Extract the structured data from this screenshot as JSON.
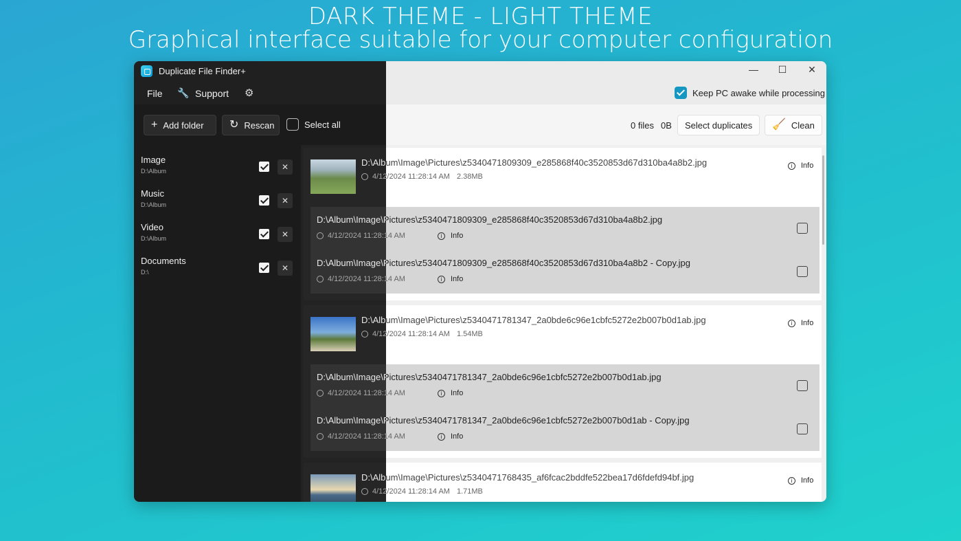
{
  "headline": {
    "line1": "DARK THEME - LIGHT THEME",
    "line2": "Graphical interface suitable for your computer configuration"
  },
  "app": {
    "title": "Duplicate File Finder+",
    "menu": {
      "file": "File",
      "support": "Support"
    },
    "keep_awake_label": "Keep PC awake while processing",
    "window_controls": {
      "minimize": "—",
      "maximize": "☐",
      "close": "✕"
    }
  },
  "toolbar": {
    "add_folder": "Add folder",
    "rescan": "Rescan",
    "select_all": "Select all",
    "files_count": "0 files",
    "size": "0B",
    "select_duplicates": "Select duplicates",
    "clean": "Clean"
  },
  "folders": [
    {
      "name": "Image",
      "path": "D:\\Album"
    },
    {
      "name": "Music",
      "path": "D:\\Album"
    },
    {
      "name": "Video",
      "path": "D:\\Album"
    },
    {
      "name": "Documents",
      "path": "D:\\"
    }
  ],
  "info_label": "Info",
  "groups": [
    {
      "path": "D:\\Album\\Image\\Pictures\\z5340471809309_e285868f40c3520853d67d310ba4a8b2.jpg",
      "date": "4/12/2024 11:28:14 AM",
      "size": "2.38MB",
      "duplicates": [
        {
          "path": "D:\\Album\\Image\\Pictures\\z5340471809309_e285868f40c3520853d67d310ba4a8b2.jpg",
          "date": "4/12/2024 11:28:14 AM"
        },
        {
          "path": "D:\\Album\\Image\\Pictures\\z5340471809309_e285868f40c3520853d67d310ba4a8b2 - Copy.jpg",
          "date": "4/12/2024 11:28:14 AM"
        }
      ]
    },
    {
      "path": "D:\\Album\\Image\\Pictures\\z5340471781347_2a0bde6c96e1cbfc5272e2b007b0d1ab.jpg",
      "date": "4/12/2024 11:28:14 AM",
      "size": "1.54MB",
      "duplicates": [
        {
          "path": "D:\\Album\\Image\\Pictures\\z5340471781347_2a0bde6c96e1cbfc5272e2b007b0d1ab.jpg",
          "date": "4/12/2024 11:28:14 AM"
        },
        {
          "path": "D:\\Album\\Image\\Pictures\\z5340471781347_2a0bde6c96e1cbfc5272e2b007b0d1ab - Copy.jpg",
          "date": "4/12/2024 11:28:14 AM"
        }
      ]
    },
    {
      "path": "D:\\Album\\Image\\Pictures\\z5340471768435_af6fcac2bddfe522bea17d6fdefd94bf.jpg",
      "date": "4/12/2024 11:28:14 AM",
      "size": "1.71MB",
      "duplicates": []
    }
  ],
  "colors": {
    "accent": "#1498c2",
    "dark_bg": "#1e1e1e",
    "light_bg": "#fafafa"
  }
}
